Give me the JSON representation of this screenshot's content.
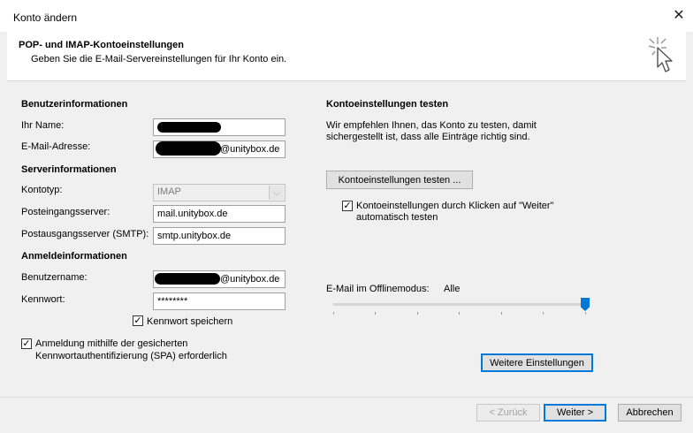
{
  "window": {
    "title": "Konto ändern",
    "close_glyph": "✕"
  },
  "header": {
    "title": "POP- und IMAP-Kontoeinstellungen",
    "subtitle": "Geben Sie die E-Mail-Servereinstellungen für Ihr Konto ein."
  },
  "user_info": {
    "section": "Benutzerinformationen",
    "name_label": "Ihr Name:",
    "email_label": "E-Mail-Adresse:",
    "email_suffix": "@unitybox.de"
  },
  "server_info": {
    "section": "Serverinformationen",
    "account_type_label": "Kontotyp:",
    "account_type_value": "IMAP",
    "incoming_label": "Posteingangsserver:",
    "incoming_value": "mail.unitybox.de",
    "outgoing_label": "Postausgangsserver (SMTP):",
    "outgoing_value": "smtp.unitybox.de"
  },
  "login_info": {
    "section": "Anmeldeinformationen",
    "username_label": "Benutzername:",
    "username_suffix": "@unitybox.de",
    "password_label": "Kennwort:",
    "password_value": "********",
    "remember_label": "Kennwort speichern",
    "remember_checked": true,
    "spa_label_line1": "Anmeldung mithilfe der gesicherten",
    "spa_label_line2": "Kennwortauthentifizierung (SPA) erforderlich",
    "spa_checked": true
  },
  "test_settings": {
    "section": "Kontoeinstellungen testen",
    "desc_line1": "Wir empfehlen Ihnen, das Konto zu testen, damit",
    "desc_line2": "sichergestellt ist, dass alle Einträge richtig sind.",
    "test_button": "Kontoeinstellungen testen ...",
    "auto_test_line1": "Kontoeinstellungen durch Klicken auf \"Weiter\"",
    "auto_test_line2": "automatisch testen",
    "auto_test_checked": true
  },
  "offline": {
    "label": "E-Mail im Offlinemodus:",
    "value": "Alle",
    "slider_level": 1.0
  },
  "buttons": {
    "more_settings": "Weitere Einstellungen",
    "back": "< Zurück",
    "next": "Weiter >",
    "cancel": "Abbrechen"
  },
  "icons": {
    "wizard": "wizard-sparkle-cursor-icon",
    "checkmark": "✓"
  }
}
